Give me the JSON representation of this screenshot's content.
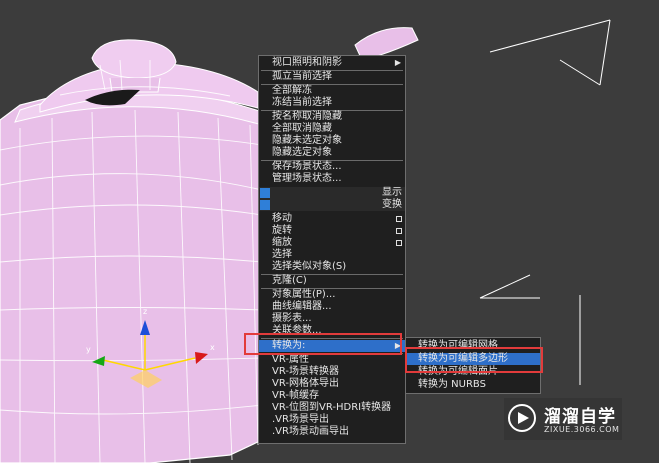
{
  "quad_menu": {
    "top_items": [
      {
        "label": "视口照明和阴影",
        "submenu": true
      },
      {
        "label": "孤立当前选择"
      },
      {
        "label": "全部解冻"
      },
      {
        "label": "冻结当前选择"
      },
      {
        "label": "按名称取消隐藏"
      },
      {
        "label": "全部取消隐藏"
      },
      {
        "label": "隐藏未选定对象"
      },
      {
        "label": "隐藏选定对象"
      },
      {
        "label": "保存场景状态..."
      },
      {
        "label": "管理场景状态..."
      }
    ],
    "quad_display": "显示",
    "quad_transform": "变换",
    "transform_items": [
      {
        "label": "移动",
        "box": true
      },
      {
        "label": "旋转",
        "box": true
      },
      {
        "label": "缩放",
        "box": true
      },
      {
        "label": "选择"
      },
      {
        "label": "选择类似对象(S)"
      },
      {
        "label": "克隆(C)"
      },
      {
        "label": "对象属性(P)..."
      },
      {
        "label": "曲线编辑器..."
      },
      {
        "label": "摄影表..."
      },
      {
        "label": "关联参数..."
      },
      {
        "label": "转换为:",
        "submenu": true
      },
      {
        "label": "VR-属性"
      },
      {
        "label": "VR-场景转换器"
      },
      {
        "label": "VR-网格体导出"
      },
      {
        "label": "VR-帧缓存"
      },
      {
        "label": "VR-位图到VR-HDRI转换器"
      },
      {
        "label": ".VR场景导出"
      },
      {
        "label": ".VR场景动画导出"
      }
    ]
  },
  "convert_submenu": {
    "items": [
      {
        "label": "转换为可编辑网格"
      },
      {
        "label": "转换为可编辑多边形"
      },
      {
        "label": "转换为可编辑面片"
      },
      {
        "label": "转换为 NURBS"
      }
    ],
    "highlighted_index": 1
  },
  "gizmo": {
    "x_label": "x",
    "y_label": "y",
    "z_label": "z"
  },
  "watermark": {
    "title": "溜溜自学",
    "url": "ZIXUE.3066.COM"
  },
  "colors": {
    "menu_bg": "#1f1f1f",
    "highlight": "#2e6fc9",
    "red_box": "#e23b3b",
    "teapot": "#e8bfe8",
    "wire": "#ffffff"
  }
}
